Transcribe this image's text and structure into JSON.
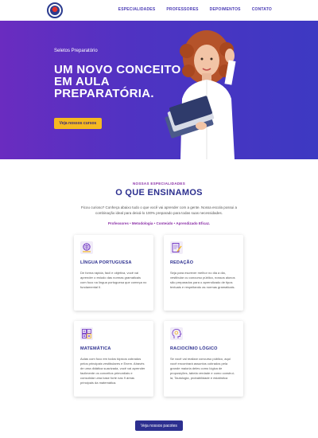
{
  "nav": {
    "items": [
      "ESPECIALIDADES",
      "PROFESSORES",
      "DEPOIMENTOS",
      "CONTATO"
    ]
  },
  "hero": {
    "kicker": "Seletos Preparatório",
    "title": "UM NOVO CONCEITO EM AULA PREPARATÓRIA.",
    "button": "Veja nossos cursos"
  },
  "section": {
    "kicker": "NOSSAS ESPECIALIDADES",
    "title": "O QUE ENSINAMOS",
    "description": "Ficou curioso? Conheça abaixo tudo o que você vai aprender com a gente. Nossa escola possui a combinação ideal para deixá-lo 100% preparado para todas suas necessidades.",
    "tags": "Professores • Metodologia • Conteúdo • Aprendizado Eficaz."
  },
  "cards": [
    {
      "icon": "globe-book-icon",
      "title": "LÍNGUA PORTUGUESA",
      "text": "De forma rápida, fácil e objetiva, você vai aprender o estudo das normas gramaticais com foco na língua portuguesa que começa no fundamental II."
    },
    {
      "icon": "writing-icon",
      "title": "REDAÇÃO",
      "text": "Seja para escrever melhor no dia a dia, vestibular ou concurso público, nossos alunos são preparados para o aprendizado de tipos textuais e respeitando as normas gramaticais."
    },
    {
      "icon": "calculator-icon",
      "title": "MATEMÁTICA",
      "text": "Aulas com foco em todos tópicos cobrados pelos principais vestibulares e Enem. Através de uma didática suavizada, você vai aprender facilmente os conceitos primordiais e consolidar uma base forte nas 9 áreas principais da matemática."
    },
    {
      "icon": "head-gears-icon",
      "title": "RACIOCÍNIO LÓGICO",
      "text": "Se você vai realizar concurso público, aqui você encontrará assuntos cobrados pela grande maioria deles como lógica de proposições, tabela verdade e como construí-la, Tautologia, probabilidade e estatística"
    }
  ],
  "bottom_button": "Veja nossos pacotes",
  "colors": {
    "hero_gradient_start": "#6a2cc0",
    "hero_gradient_end": "#3d39c2",
    "accent_yellow": "#f5b921",
    "title_navy": "#2c2f8f",
    "kicker_purple": "#8b2fa7"
  }
}
